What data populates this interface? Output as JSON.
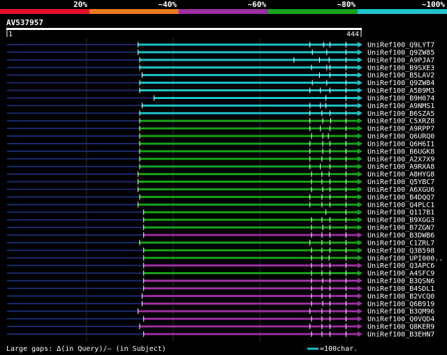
{
  "query": {
    "id": "AV537957",
    "start_label": "1",
    "end_label": "444",
    "length": 444
  },
  "identity_scale": [
    {
      "label": "20%",
      "color": "#e8112d"
    },
    {
      "label": "~40%",
      "color": "#e87a1c"
    },
    {
      "label": "~60%",
      "color": "#9b2fa0"
    },
    {
      "label": "~80%",
      "color": "#18a318"
    },
    {
      "label": "~100%",
      "color": "#1ec3cc"
    }
  ],
  "colors": {
    "background": "#000000",
    "query_line": "#ffffff",
    "unaligned": "#1a2a6e",
    "grid": "#2a2a2a",
    "white_tick": "#ffffff"
  },
  "footer": {
    "legend_text": "Large gaps: ∆(in Query)/– (in Subject)",
    "scale_text": "=100char.",
    "scale_color": "#1ec3cc"
  },
  "chart_data": {
    "type": "alignment",
    "x_unit": "residue position in query",
    "xlim": [
      1,
      444
    ],
    "series": [
      {
        "name": "UniRef100_Q9LYT7",
        "start": 165,
        "end": 444,
        "identity": "~100%",
        "ticks": [
          380,
          397,
          405,
          425
        ]
      },
      {
        "name": "UniRef100_Q9ZW85",
        "start": 165,
        "end": 444,
        "identity": "~100%",
        "ticks": [
          383,
          401,
          425
        ]
      },
      {
        "name": "UniRef100_A9PJA7",
        "start": 167,
        "end": 444,
        "identity": "~100%",
        "ticks": [
          360,
          392,
          404,
          425
        ]
      },
      {
        "name": "UniRef100_B9SXE3",
        "start": 167,
        "end": 444,
        "identity": "~100%",
        "ticks": [
          382,
          401,
          405,
          425
        ]
      },
      {
        "name": "UniRef100_B5LAV2",
        "start": 170,
        "end": 444,
        "identity": "~100%",
        "ticks": [
          392,
          405,
          425
        ]
      },
      {
        "name": "UniRef100_Q9ZW84",
        "start": 167,
        "end": 444,
        "identity": "~100%",
        "ticks": [
          383,
          401,
          425
        ]
      },
      {
        "name": "UniRef100_A5B9M3",
        "start": 167,
        "end": 444,
        "identity": "~100%",
        "ticks": [
          380,
          393,
          405,
          425
        ]
      },
      {
        "name": "UniRef100_B9H074",
        "start": 185,
        "end": 444,
        "identity": "~100%",
        "ticks": [
          400,
          425
        ]
      },
      {
        "name": "UniRef100_A9NMS1",
        "start": 170,
        "end": 444,
        "identity": "~100%",
        "ticks": [
          380,
          393,
          400,
          425
        ]
      },
      {
        "name": "UniRef100_B6SZA5",
        "start": 167,
        "end": 444,
        "identity": "~100%",
        "ticks": [
          380,
          395,
          405,
          425
        ]
      },
      {
        "name": "UniRef100_C5XRZ8",
        "start": 167,
        "end": 444,
        "identity": "~80%",
        "ticks": [
          380,
          396,
          406,
          425
        ]
      },
      {
        "name": "UniRef100_A9RPP7",
        "start": 167,
        "end": 444,
        "identity": "~80%",
        "ticks": [
          380,
          393,
          405,
          425
        ]
      },
      {
        "name": "UniRef100_Q6URQ0",
        "start": 167,
        "end": 444,
        "identity": "~80%",
        "ticks": [
          382,
          396,
          403,
          425
        ]
      },
      {
        "name": "UniRef100_Q6H6I1",
        "start": 167,
        "end": 444,
        "identity": "~80%",
        "ticks": [
          380,
          396,
          405,
          425
        ]
      },
      {
        "name": "UniRef100_B6UGK8",
        "start": 167,
        "end": 444,
        "identity": "~80%",
        "ticks": [
          380,
          396,
          405,
          425
        ]
      },
      {
        "name": "UniRef100_A2X7X9",
        "start": 167,
        "end": 444,
        "identity": "~80%",
        "ticks": [
          380,
          395,
          405,
          425
        ]
      },
      {
        "name": "UniRef100_A9RXA8",
        "start": 167,
        "end": 444,
        "identity": "~80%",
        "ticks": [
          380,
          393,
          405,
          425
        ]
      },
      {
        "name": "UniRef100_A8HYG8",
        "start": 165,
        "end": 444,
        "identity": "~80%",
        "ticks": [
          382,
          395,
          404,
          425
        ]
      },
      {
        "name": "UniRef100_Q5YBC7",
        "start": 165,
        "end": 444,
        "identity": "~80%",
        "ticks": [
          382,
          395,
          405,
          425
        ]
      },
      {
        "name": "UniRef100_A6XGU6",
        "start": 165,
        "end": 444,
        "identity": "~80%",
        "ticks": [
          382,
          396,
          405,
          425
        ]
      },
      {
        "name": "UniRef100_B4DQQ7",
        "start": 167,
        "end": 444,
        "identity": "~80%",
        "ticks": [
          380,
          395,
          405,
          425
        ]
      },
      {
        "name": "UniRef100_Q4PLC1",
        "start": 165,
        "end": 444,
        "identity": "~80%",
        "ticks": [
          380,
          395,
          405,
          425
        ]
      },
      {
        "name": "UniRef100_Q117B1",
        "start": 172,
        "end": 444,
        "identity": "~80%",
        "ticks": [
          400,
          425
        ]
      },
      {
        "name": "UniRef100_B9XGG3",
        "start": 172,
        "end": 444,
        "identity": "~80%",
        "ticks": [
          382,
          395,
          405,
          425
        ]
      },
      {
        "name": "UniRef100_B7ZGN7",
        "start": 172,
        "end": 444,
        "identity": "~80%",
        "ticks": [
          382,
          396,
          405,
          425
        ]
      },
      {
        "name": "UniRef100_B3DWB6",
        "start": 172,
        "end": 444,
        "identity": "~60%",
        "ticks": [
          382,
          395,
          405,
          425
        ]
      },
      {
        "name": "UniRef100_C1ZRL7",
        "start": 167,
        "end": 444,
        "identity": "~80%",
        "ticks": [
          380,
          395,
          405,
          425
        ]
      },
      {
        "name": "UniRef100_Q3B598",
        "start": 172,
        "end": 444,
        "identity": "~80%",
        "ticks": [
          382,
          395,
          405,
          425
        ]
      },
      {
        "name": "UniRef100_UPI000..",
        "start": 172,
        "end": 444,
        "identity": "~80%",
        "ticks": [
          382,
          395,
          404,
          425
        ]
      },
      {
        "name": "UniRef100_Q3APC6",
        "start": 172,
        "end": 444,
        "identity": "~60%",
        "ticks": [
          382,
          395,
          405,
          425
        ]
      },
      {
        "name": "UniRef100_A4SFC9",
        "start": 172,
        "end": 444,
        "identity": "~80%",
        "ticks": [
          382,
          395,
          405,
          425
        ]
      },
      {
        "name": "UniRef100_B3QSN6",
        "start": 172,
        "end": 444,
        "identity": "~60%",
        "ticks": [
          382,
          396,
          405,
          425
        ]
      },
      {
        "name": "UniRef100_B4SDL1",
        "start": 172,
        "end": 444,
        "identity": "~60%",
        "ticks": [
          382,
          395,
          405,
          425
        ]
      },
      {
        "name": "UniRef100_B2VCQ0",
        "start": 170,
        "end": 444,
        "identity": "~60%",
        "ticks": [
          382,
          395,
          405,
          425
        ]
      },
      {
        "name": "UniRef100_Q6B919",
        "start": 170,
        "end": 444,
        "identity": "~60%",
        "ticks": [
          382,
          396,
          405,
          425
        ]
      },
      {
        "name": "UniRef100_B3QM96",
        "start": 165,
        "end": 444,
        "identity": "~60%",
        "ticks": [
          380,
          395,
          405,
          425
        ]
      },
      {
        "name": "UniRef100_Q0VQD4",
        "start": 172,
        "end": 444,
        "identity": "~60%",
        "ticks": [
          382,
          395,
          405,
          425
        ]
      },
      {
        "name": "UniRef100_Q8KER9",
        "start": 167,
        "end": 444,
        "identity": "~60%",
        "ticks": [
          380,
          395,
          405,
          425
        ]
      },
      {
        "name": "UniRef100_B3EHN7",
        "start": 172,
        "end": 444,
        "identity": "~60%",
        "ticks": [
          382,
          395,
          405,
          425
        ]
      }
    ]
  }
}
